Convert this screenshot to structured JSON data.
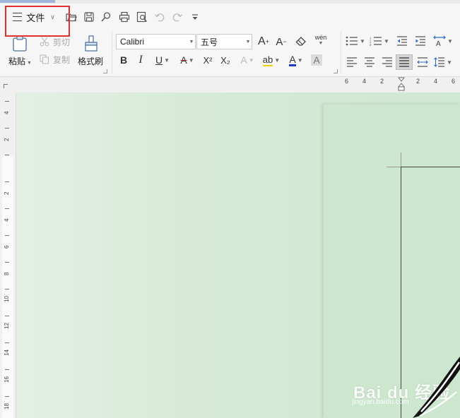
{
  "quick_access": {
    "file_menu_label": "文件"
  },
  "clipboard": {
    "paste_label": "粘贴",
    "cut_label": "剪切",
    "copy_label": "复制",
    "format_painter_label": "格式刷"
  },
  "font": {
    "font_name": "Calibri",
    "font_size": "五号",
    "bold_glyph": "B",
    "italic_glyph": "I",
    "underline_glyph": "U",
    "strike_glyph": "A",
    "superscript_glyph": "X²",
    "subscript_glyph": "X₂",
    "text_effect_glyph": "A",
    "highlight_glyph": "ab",
    "font_color_glyph": "A",
    "char_shading_glyph": "A",
    "grow_glyph": "A",
    "shrink_glyph": "A",
    "phonetic_glyph": "wén"
  },
  "paragraph": {
    "active_alignment": "justify"
  },
  "ruler": {
    "horizontal_labels": [
      "6",
      "4",
      "2",
      "2",
      "4",
      "6"
    ],
    "vertical_labels": [
      "4",
      "2",
      "2",
      "4",
      "6",
      "8",
      "10",
      "12",
      "14",
      "16",
      "18"
    ]
  },
  "watermark": {
    "brand": "Bai du 经验",
    "site": "jingyan.baidu.com"
  },
  "colors": {
    "highlight_box": "#e03030",
    "document_background": "#cfe8d3",
    "font_color_bar": "#1a3cc8"
  }
}
